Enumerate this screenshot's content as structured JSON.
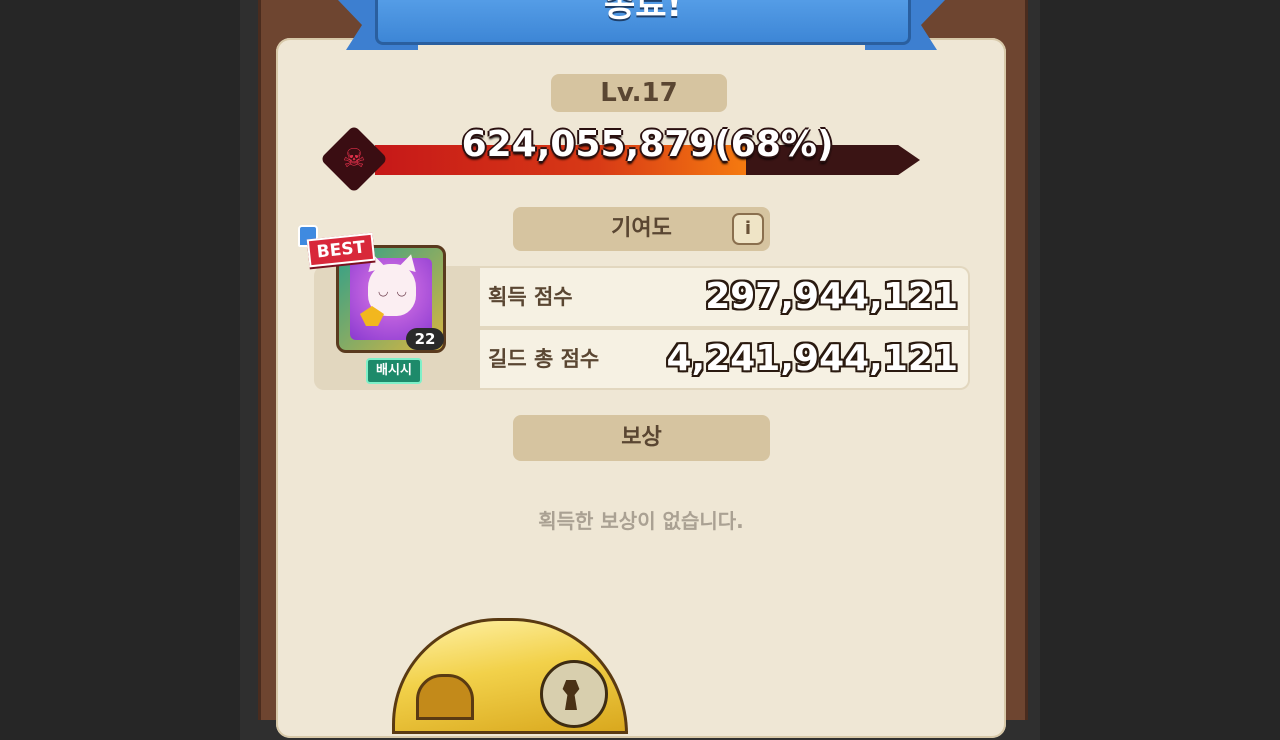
{
  "header": {
    "title": "종료!"
  },
  "boss": {
    "level": "Lv.17",
    "hp_text": "624,055,879(68%)",
    "hp_percent": 68
  },
  "contribution": {
    "title": "기여도",
    "info_icon": "i",
    "character": {
      "best_label": "BEST",
      "level": "22",
      "name": "배시시"
    },
    "rows": [
      {
        "label": "획득 점수",
        "value": "297,944,121"
      },
      {
        "label": "길드 총 점수",
        "value": "4,241,944,121"
      }
    ]
  },
  "rewards": {
    "title": "보상",
    "empty_message": "획득한 보상이 없습니다."
  },
  "colors": {
    "ribbon": "#3d86d6",
    "parchment": "#efe7d5",
    "hp_fill": "#d83a16",
    "accent_tan": "#d6c4a0"
  }
}
